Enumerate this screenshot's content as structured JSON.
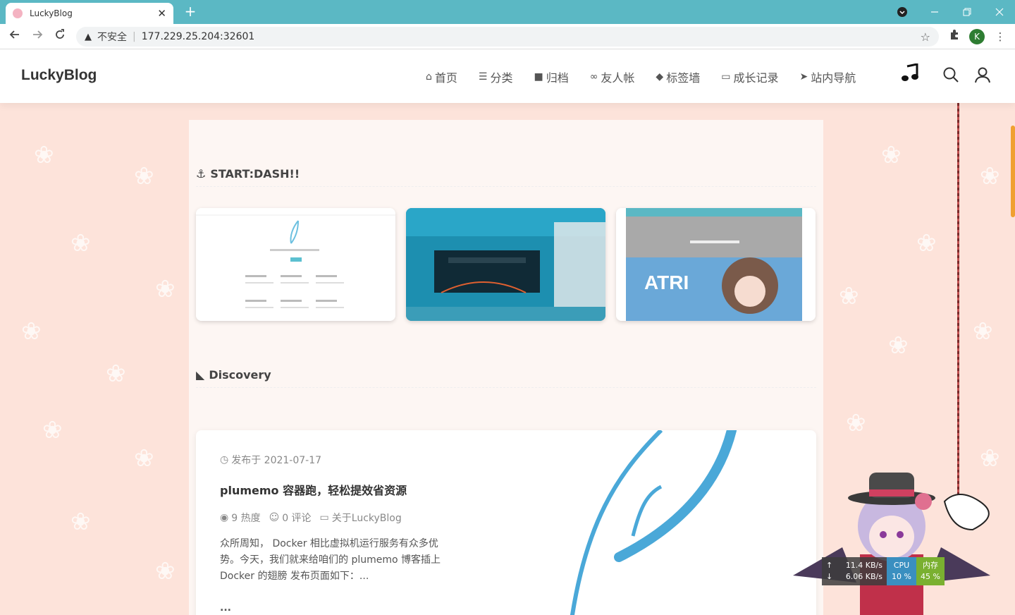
{
  "browser": {
    "tab_title": "LuckyBlog",
    "tab_close": "✕",
    "new_tab": "+",
    "insecure_label": "不安全",
    "url": "177.229.25.204:32601",
    "profile_initial": "K"
  },
  "header": {
    "logo": "LuckyBlog",
    "nav": [
      {
        "label": "首页",
        "icon": "home-icon",
        "glyph": "⌂"
      },
      {
        "label": "分类",
        "icon": "list-icon",
        "glyph": "☰"
      },
      {
        "label": "归档",
        "icon": "archive-icon",
        "glyph": "■"
      },
      {
        "label": "友人帐",
        "icon": "link-icon",
        "glyph": "∞"
      },
      {
        "label": "标签墙",
        "icon": "tag-icon",
        "glyph": "◆"
      },
      {
        "label": "成长记录",
        "icon": "folder-icon",
        "glyph": "▭"
      },
      {
        "label": "站内导航",
        "icon": "send-icon",
        "glyph": "➤"
      }
    ]
  },
  "sections": {
    "start_dash": "START:DASH!!",
    "discovery": "Discovery"
  },
  "post": {
    "date_label": "发布于 2021-07-17",
    "title": "plumemo 容器跑，轻松提效省资源",
    "views": "9 热度",
    "comments": "0 评论",
    "category": "关于LuckyBlog",
    "excerpt": "众所周知， Docker 相比虚拟机运行服务有众多优势。今天，我们就来给咱们的 plumemo 博客插上 Docker 的翅膀 发布页面如下：...",
    "more": "..."
  },
  "monitor": {
    "upload": "11.4 KB/s",
    "download": "6.06 KB/s",
    "cpu_label": "CPU",
    "cpu_value": "10 %",
    "mem_label": "内存",
    "mem_value": "45 %"
  },
  "colors": {
    "tabbar": "#5bb8c4",
    "page_bg": "#fde3da",
    "accent_blue": "#4aa8d8",
    "scroll_thumb": "#f0a030"
  }
}
